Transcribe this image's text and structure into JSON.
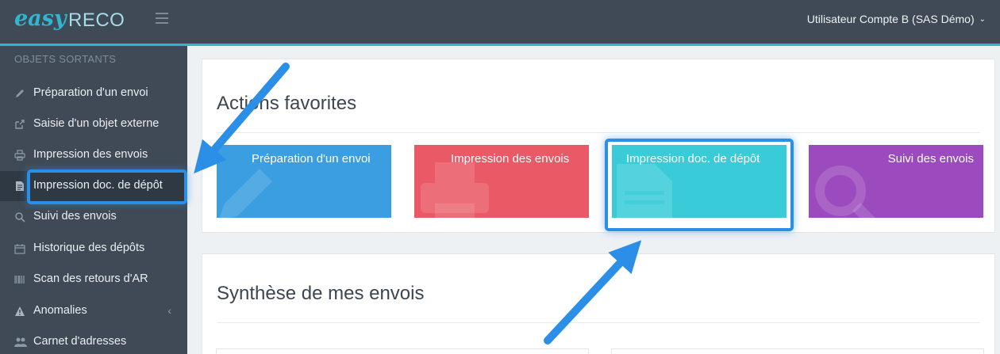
{
  "app": {
    "logo_part1": "easy",
    "logo_part2": "RECO",
    "user_menu_label": "Utilisateur Compte B (SAS Démo)"
  },
  "sidebar": {
    "section_title": "OBJETS SORTANTS",
    "items": [
      {
        "label": "Préparation d'un envoi",
        "icon": "pencil-icon"
      },
      {
        "label": "Saisie d'un objet externe",
        "icon": "external-link-icon"
      },
      {
        "label": "Impression des envois",
        "icon": "printer-icon"
      },
      {
        "label": "Impression doc. de dépôt",
        "icon": "document-icon",
        "active": true
      },
      {
        "label": "Suivi des envois",
        "icon": "search-icon"
      },
      {
        "label": "Historique des dépôts",
        "icon": "calendar-icon"
      },
      {
        "label": "Scan des retours d'AR",
        "icon": "barcode-icon"
      },
      {
        "label": "Anomalies",
        "icon": "warning-icon",
        "has_submenu": true
      },
      {
        "label": "Carnet d'adresses",
        "icon": "users-icon"
      }
    ]
  },
  "main": {
    "favorites_title": "Actions favorites",
    "tiles": [
      {
        "label": "Préparation d'un envoi",
        "color": "#3a9ee0",
        "icon": "pencil-icon"
      },
      {
        "label": "Impression des envois",
        "color": "#e95a66",
        "icon": "printer-icon"
      },
      {
        "label": "Impression doc. de dépôt",
        "color": "#39cbd8",
        "icon": "document-icon"
      },
      {
        "label": "Suivi des envois",
        "color": "#9b4bbd",
        "icon": "search-icon"
      }
    ],
    "summary_title": "Synthèse de mes envois"
  },
  "colors": {
    "topbar": "#3f4a56",
    "accent": "#29b8cf",
    "annotation": "#2b8fe8"
  }
}
